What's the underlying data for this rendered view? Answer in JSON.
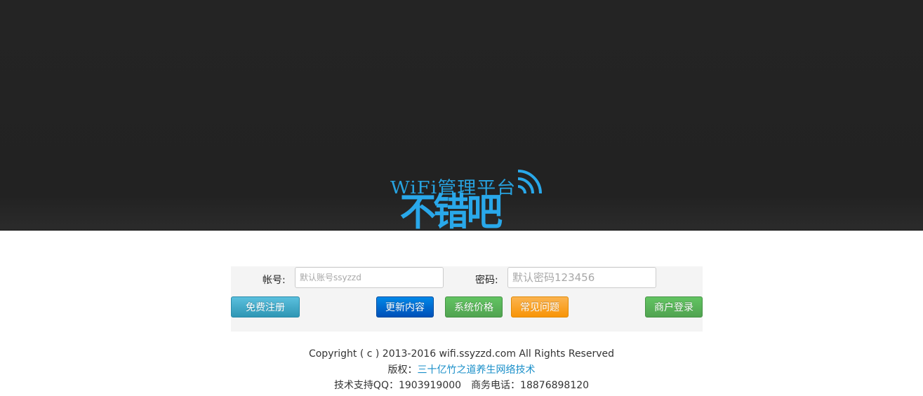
{
  "logo": {
    "subtitle": "WiFi管理平台",
    "brand": "不错吧",
    "icon": "wifi-signal-icon",
    "color": "#29a8ea"
  },
  "login": {
    "account_label": "帐号:",
    "account_placeholder": "默认账号ssyzzd",
    "password_label": "密码:",
    "password_placeholder": "默认密码123456"
  },
  "buttons": {
    "register": "免费注册",
    "updates": "更新内容",
    "pricing": "系统价格",
    "faq": "常见问题",
    "merchant_login": "商户登录"
  },
  "footer": {
    "copyright": "Copyright ( c ) 2013-2016 wifi.ssyzzd.com All Rights Reserved",
    "rights_prefix": "版权：",
    "rights_owner": "三十亿竹之道养生网络技术",
    "support_qq": "技术支持QQ：1903919000",
    "business_phone": "商务电话：18876898120"
  }
}
